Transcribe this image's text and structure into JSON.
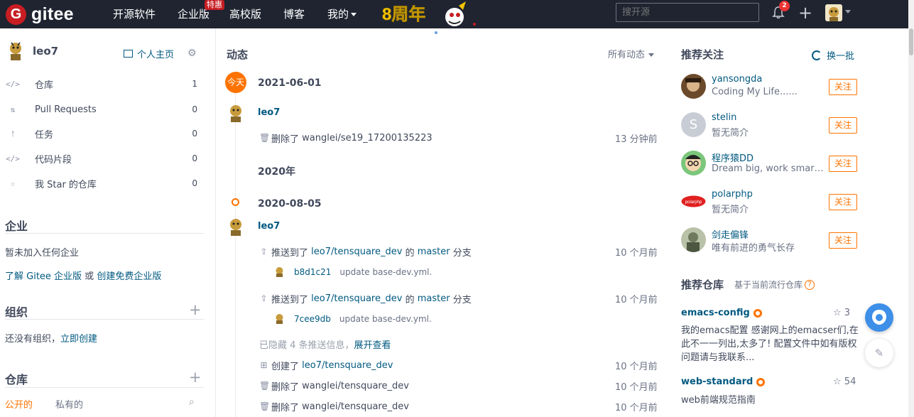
{
  "brand": {
    "logo_letter": "G",
    "name": "gitee"
  },
  "nav": {
    "items": [
      "开源软件",
      "企业版",
      "高校版",
      "博客",
      "我的"
    ],
    "hot_badge": "特惠",
    "anniversary": "8周年"
  },
  "header": {
    "search_placeholder": "搜开源",
    "notification_count": "2"
  },
  "left": {
    "username": "leo7",
    "homepage_label": "个人主页",
    "menu": [
      {
        "icon": "</>",
        "label": "仓库",
        "count": "1"
      },
      {
        "icon": "⇅",
        "label": "Pull Requests",
        "count": "0"
      },
      {
        "icon": "!",
        "label": "任务",
        "count": "0"
      },
      {
        "icon": "</>",
        "label": "代码片段",
        "count": "0"
      },
      {
        "icon": "☆",
        "label": "我 Star 的仓库",
        "count": "0"
      }
    ],
    "enterprise": {
      "title": "企业",
      "none": "暂未加入任何企业",
      "learn_link": "了解 Gitee 企业版",
      "or": " 或 ",
      "create_link": "创建免费企业版"
    },
    "org": {
      "title": "组织",
      "none": "还没有组织，",
      "create_link": "立即创建"
    },
    "repo": {
      "title": "仓库",
      "tab_public": "公开的",
      "tab_private": "私有的"
    }
  },
  "feed": {
    "title": "动态",
    "filter": "所有动态",
    "today_badge": "今天",
    "dates": [
      "2021-06-01",
      "2020年",
      "2020-08-05"
    ],
    "user": "leo7",
    "events": [
      {
        "action": "删除了",
        "target": "wanglei/se19_17200135223",
        "time": "13 分钟前"
      },
      {
        "action": "推送到了",
        "target": "leo7/tensquare_dev",
        "of": "的",
        "branch": "master",
        "suffix": "分支",
        "time": "10 个月前",
        "sha": "b8d1c21",
        "message": "update base-dev.yml."
      },
      {
        "action": "推送到了",
        "target": "leo7/tensquare_dev",
        "of": "的",
        "branch": "master",
        "suffix": "分支",
        "time": "10 个月前",
        "sha": "7cee9db",
        "message": "update base-dev.yml."
      },
      {
        "action": "创建了",
        "target": "leo7/tensquare_dev",
        "time": "10 个月前"
      },
      {
        "action": "删除了",
        "target": "wanglei/tensquare_dev",
        "time": "10 个月前"
      },
      {
        "action": "删除了",
        "target": "wanglei/tensquare_dev",
        "time": "10 个月前"
      }
    ],
    "hidden_note": "已隐藏 4 条推送信息，",
    "expand_link": "展开查看"
  },
  "right": {
    "follow_title": "推荐关注",
    "refresh": "换一批",
    "follow_btn": "关注",
    "users": [
      {
        "name": "yansongda",
        "desc": "Coding My Life......",
        "color": "#6b4a2b"
      },
      {
        "name": "stelin",
        "desc": "暂无简介",
        "color": "#c8ccd5",
        "initial": "S"
      },
      {
        "name": "程序猿DD",
        "desc": "Dream big, work smart, deliver fast",
        "color": "#7bc67b"
      },
      {
        "name": "polarphp",
        "desc": "暂无简介",
        "color": "#e02020"
      },
      {
        "name": "剑走偏锋",
        "desc": "唯有前进的勇气长存",
        "color": "#6d7a5c"
      }
    ],
    "repo_title": "推荐仓库",
    "repo_sub": "基于当前流行仓库",
    "repos": [
      {
        "name": "emacs-config",
        "stars": "3",
        "desc": "我的emacs配置 感谢网上的emacser们,在此不一一列出,太多了! 配置文件中如有版权问题请与我联系..."
      },
      {
        "name": "web-standard",
        "stars": "54",
        "desc": "web前端规范指南"
      }
    ]
  },
  "colors": {
    "topbar": "#1f2430",
    "brand_red": "#c71d23",
    "accent_orange": "#fe7300",
    "link": "#005980"
  }
}
